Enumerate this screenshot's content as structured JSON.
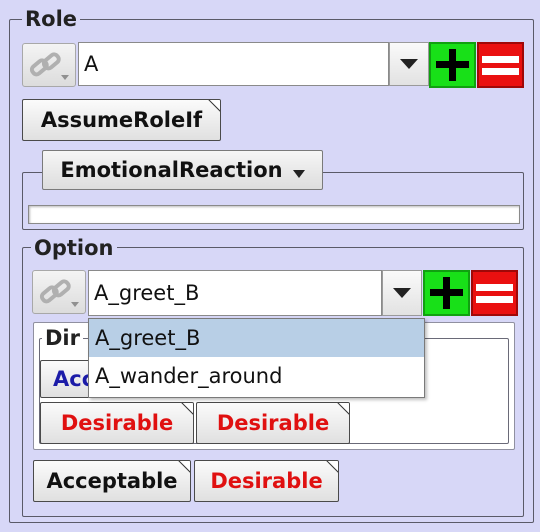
{
  "role": {
    "legend": "Role",
    "combo_value": "A",
    "assume_button": "AssumeRoleIf",
    "emotional_button": "EmotionalReaction"
  },
  "option": {
    "legend": "Option",
    "combo_value": "A_greet_B",
    "dropdown_items": [
      "A_greet_B",
      "A_wander_around"
    ],
    "inner_legend": "Dir",
    "inner_button_partial": "Acc",
    "inner_desirable_1": "Desirable",
    "inner_desirable_2": "Desirable",
    "acceptable_button": "Acceptable",
    "desirable_button": "Desirable"
  },
  "colors": {
    "background": "#d7d7f7",
    "plus_green": "#18e018",
    "minus_red": "#ea1010",
    "desirable_text": "#e01010",
    "acceptable_text_blue": "#1c1ca8"
  },
  "icons": {
    "link": "chain-link-icon",
    "dropdown": "triangle-down-icon",
    "add": "plus-icon",
    "remove": "minus-icon"
  }
}
